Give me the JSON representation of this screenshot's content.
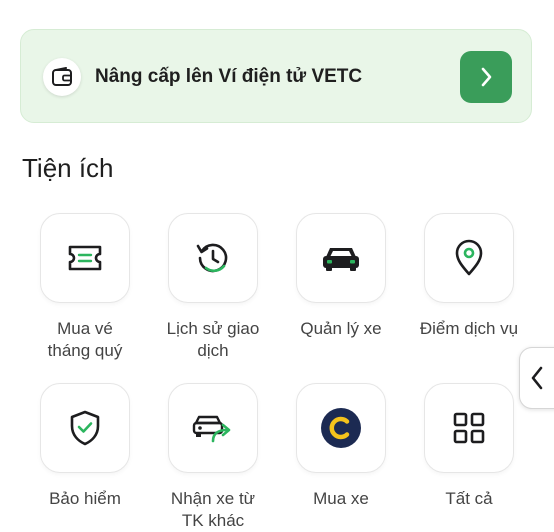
{
  "banner": {
    "text": "Nâng cấp lên Ví điện tử VETC",
    "icon": "wallet-icon",
    "action_icon": "chevron-right-icon"
  },
  "section": {
    "title": "Tiện ích"
  },
  "utilities": [
    {
      "label": "Mua vé\ntháng quý",
      "icon": "ticket-icon"
    },
    {
      "label": "Lịch sử giao\ndịch",
      "icon": "history-icon"
    },
    {
      "label": "Quản lý xe",
      "icon": "car-icon"
    },
    {
      "label": "Điểm dịch vụ",
      "icon": "location-pin-icon"
    },
    {
      "label": "Bảo hiểm",
      "icon": "shield-check-icon"
    },
    {
      "label": "Nhận xe từ\nTK khác",
      "icon": "car-transfer-icon"
    },
    {
      "label": "Mua xe",
      "icon": "coin-icon"
    },
    {
      "label": "Tất cả",
      "icon": "grid-icon"
    }
  ],
  "side_tab": {
    "icon": "chevron-left-icon"
  },
  "colors": {
    "accent_green": "#3a9d5a",
    "banner_bg": "#e9f6e8",
    "icon_green": "#2cb55e",
    "coin_navy": "#1c2a52",
    "coin_yellow": "#f4c21c"
  }
}
